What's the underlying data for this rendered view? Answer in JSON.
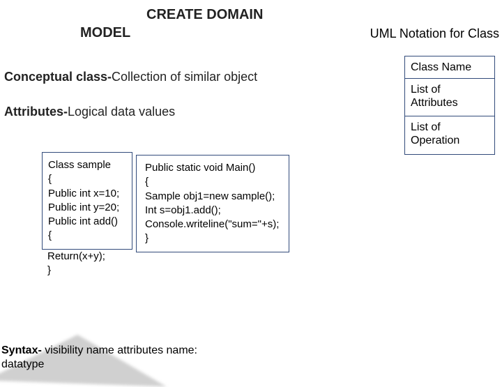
{
  "title": "CREATE DOMAIN",
  "subtitle": "MODEL",
  "uml_header": "UML Notation for Class",
  "conceptual": {
    "bold": "Conceptual class-",
    "rest": "Collection of similar object"
  },
  "attributes": {
    "bold": "Attributes-",
    "rest": "Logical data values"
  },
  "uml_box": {
    "row1": "Class Name",
    "row2": "List of Attributes",
    "row3": "List of Operation"
  },
  "code_left": {
    "l1": "Class sample",
    "l2": "{",
    "l3": "Public int x=10;",
    "l4": "Public int y=20;",
    "l5": "Public int add()",
    "l6": "{",
    "l7": "Return(x+y);",
    "l8": "}"
  },
  "code_right": {
    "l1": "Public static void Main()",
    "l2": "{",
    "l3": "Sample obj1=new sample();",
    "l4": "Int s=obj1.add();",
    "l5": "Console.writeline(\"sum=\"+s);",
    "l6": "}"
  },
  "syntax": {
    "bold": "Syntax-",
    "rest": " visibility name attributes name:"
  },
  "syntax2": "datatype"
}
